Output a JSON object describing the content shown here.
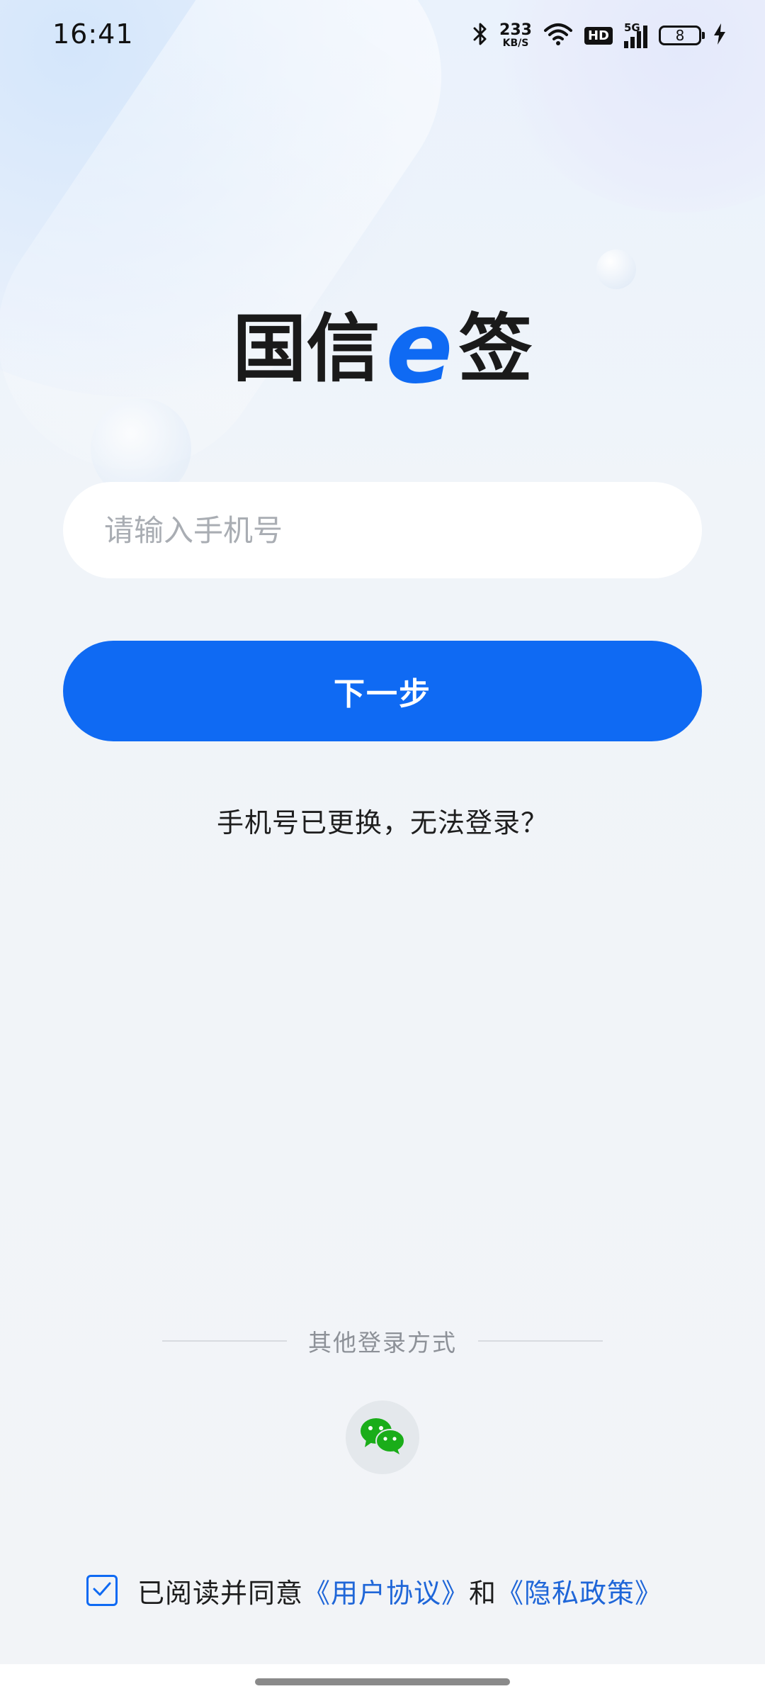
{
  "status_bar": {
    "time": "16:41",
    "net_speed_value": "233",
    "net_speed_unit": "KB/S",
    "hd_label": "HD",
    "signal_label": "5G",
    "battery_level": "8",
    "icons": [
      "bluetooth-icon",
      "wifi-icon",
      "signal-icon",
      "battery-icon",
      "charging-icon"
    ]
  },
  "logo": {
    "part1": "国信",
    "e": "e",
    "part2": "签",
    "accent_color": "#0f6af3"
  },
  "login": {
    "phone_placeholder": "请输入手机号",
    "phone_value": "",
    "next_button_label": "下一步",
    "phone_changed_link": "手机号已更换，无法登录？"
  },
  "other_login": {
    "label": "其他登录方式",
    "methods": [
      "wechat-icon"
    ]
  },
  "agreement": {
    "checked": true,
    "prefix": "已阅读并同意",
    "user_agreement_link": "《用户协议》",
    "conjunction": "和",
    "privacy_policy_link": "《隐私政策》"
  },
  "colors": {
    "primary": "#0f6af3",
    "link": "#1f66d8",
    "wechat_green": "#1aad19"
  }
}
